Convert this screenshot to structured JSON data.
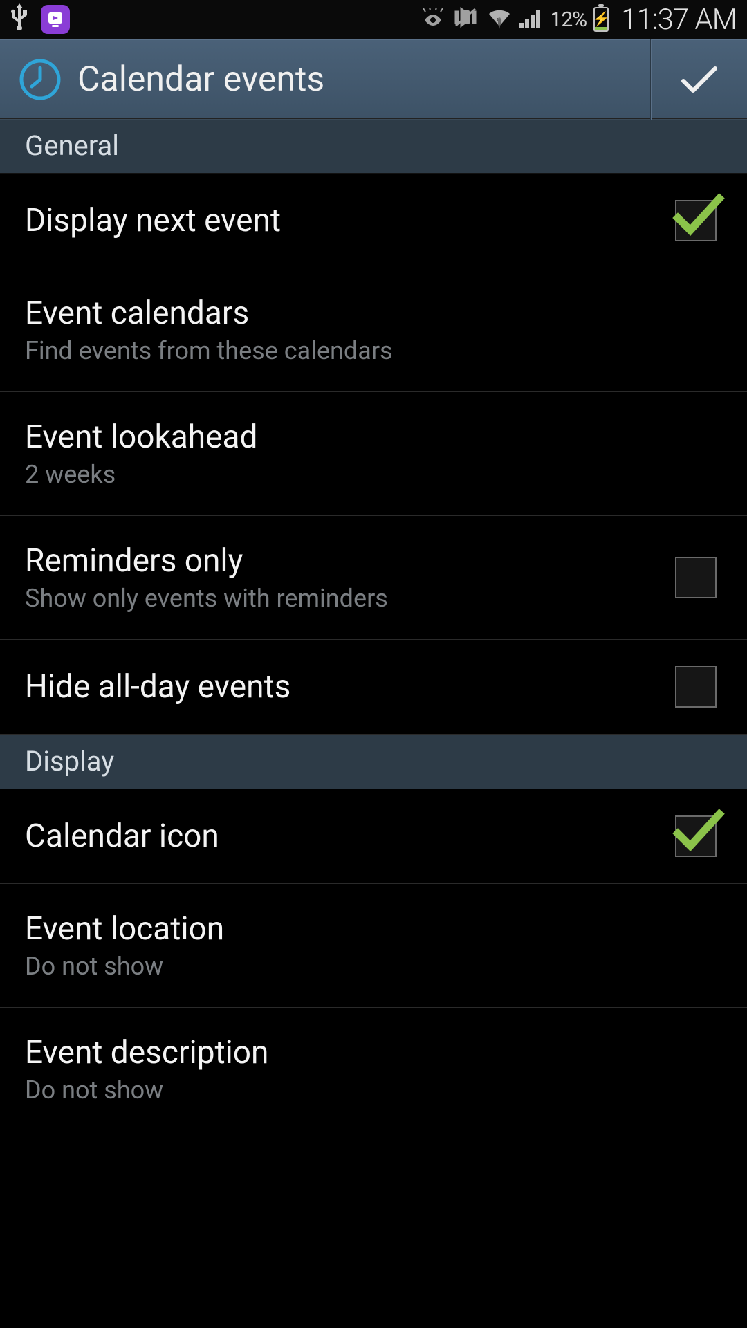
{
  "status": {
    "battery_pct": "12%",
    "time": "11:37 AM"
  },
  "action_bar": {
    "title": "Calendar events"
  },
  "sections": {
    "general": {
      "header": "General",
      "display_next_event": {
        "title": "Display next event"
      },
      "event_calendars": {
        "title": "Event calendars",
        "subtitle": "Find events from these calendars"
      },
      "event_lookahead": {
        "title": "Event lookahead",
        "subtitle": "2 weeks"
      },
      "reminders_only": {
        "title": "Reminders only",
        "subtitle": "Show only events with reminders"
      },
      "hide_all_day": {
        "title": "Hide all-day events"
      }
    },
    "display": {
      "header": "Display",
      "calendar_icon": {
        "title": "Calendar icon"
      },
      "event_location": {
        "title": "Event location",
        "subtitle": "Do not show"
      },
      "event_description": {
        "title": "Event description",
        "subtitle": "Do not show"
      }
    }
  }
}
